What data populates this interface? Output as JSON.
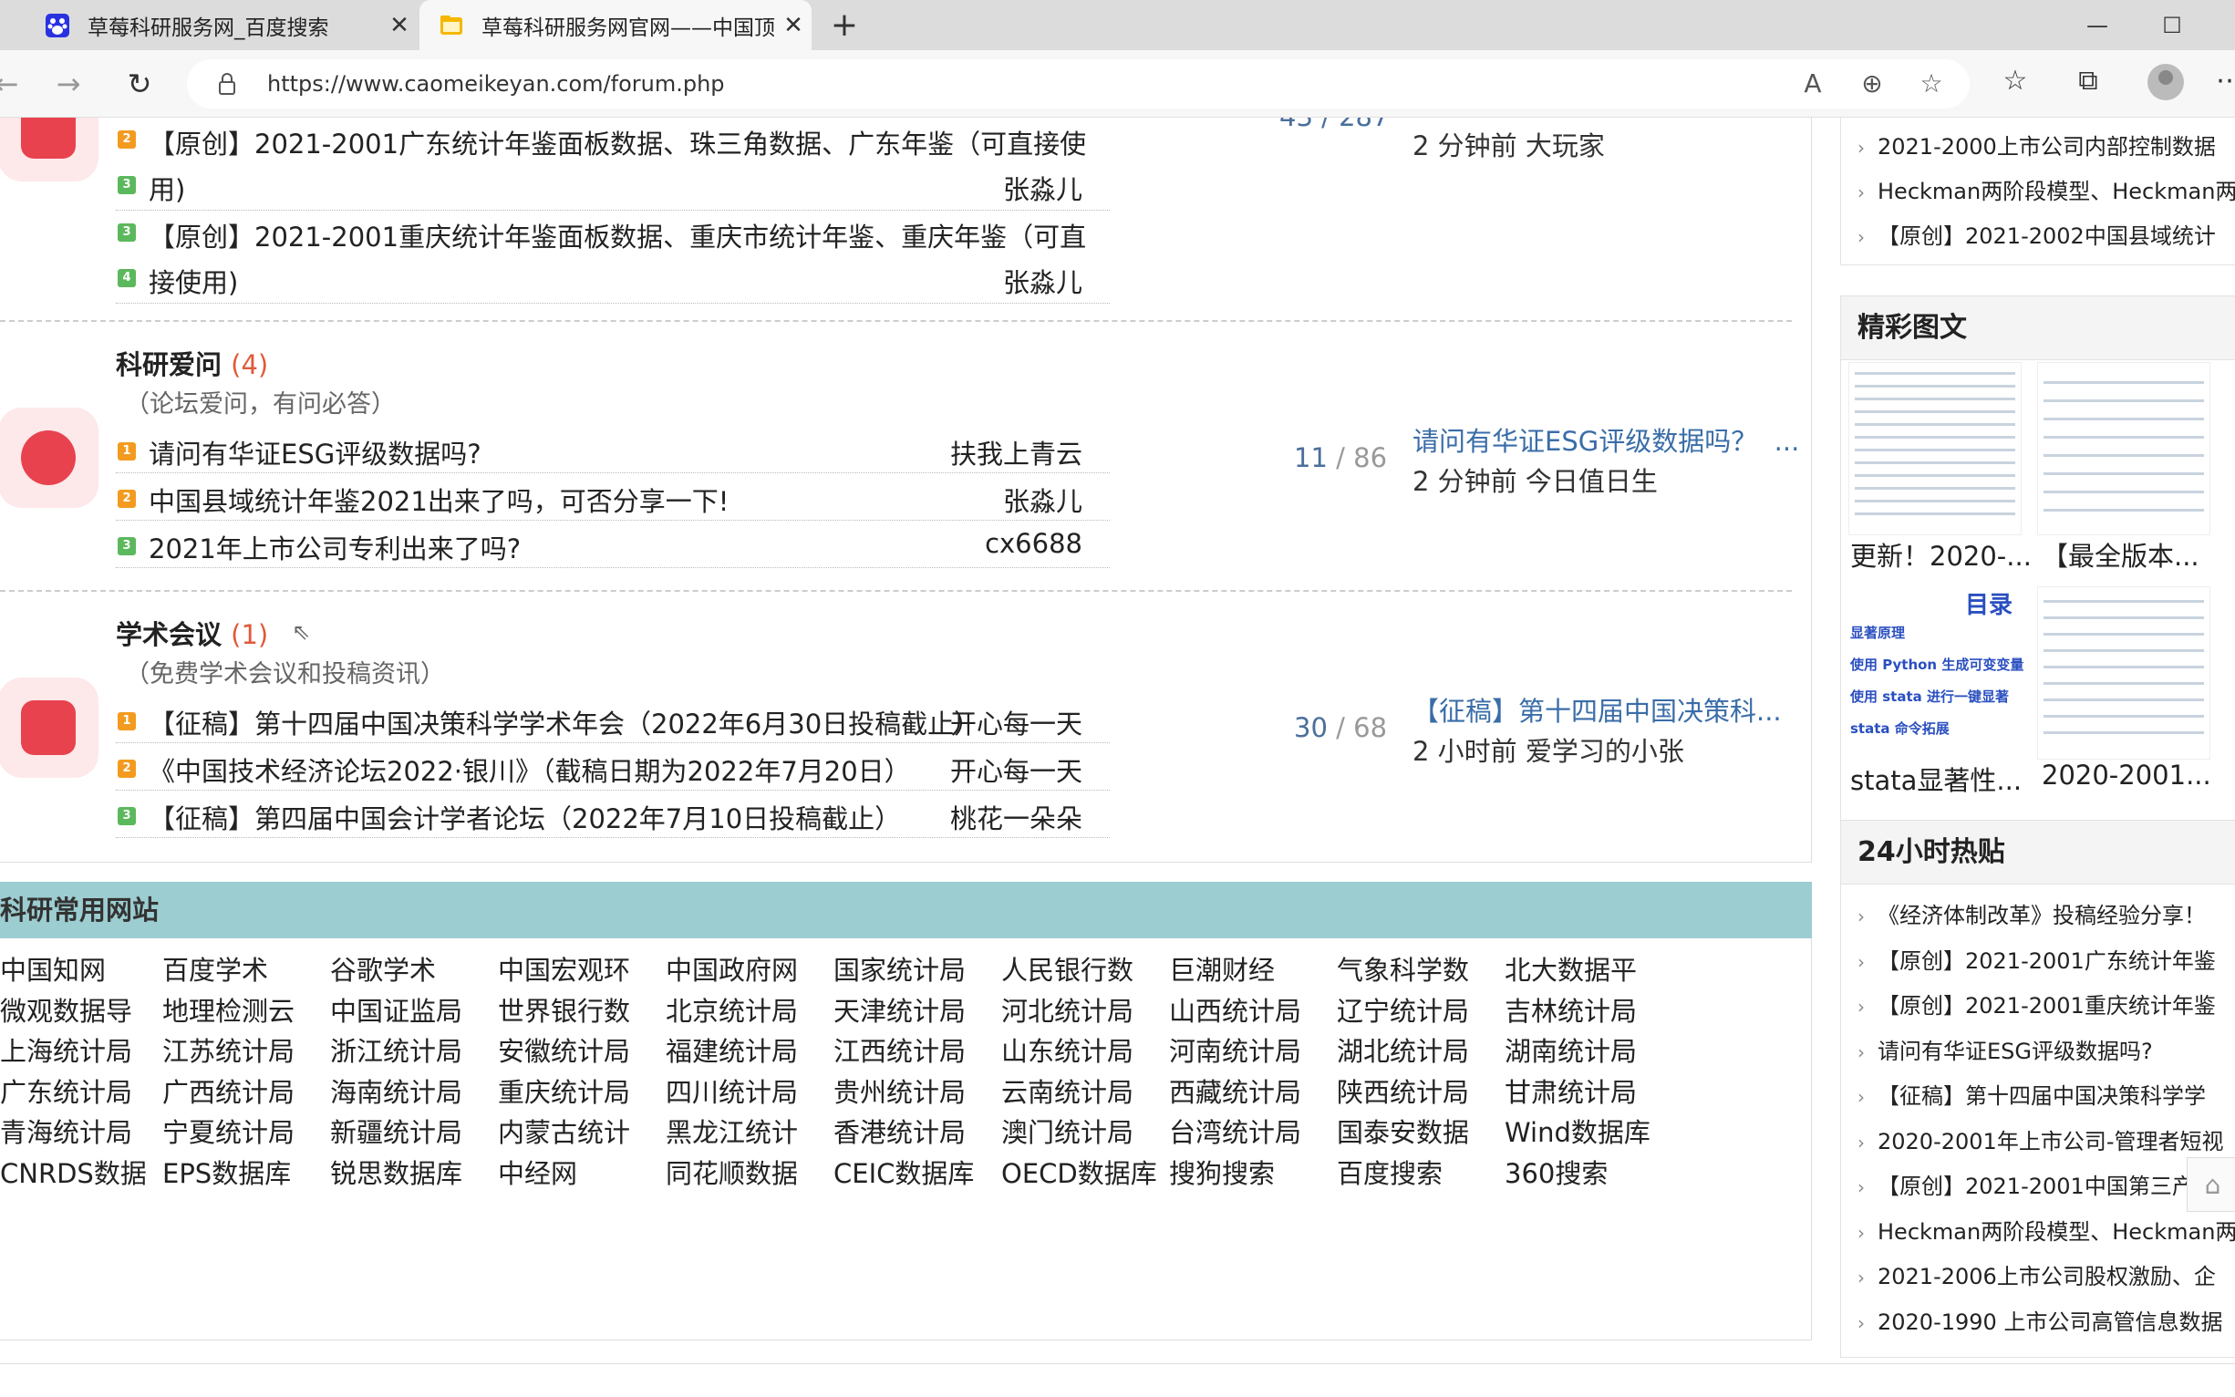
{
  "browser": {
    "tabs": [
      {
        "title": "草莓科研服务网_百度搜索",
        "icon": "baidu-paw-icon",
        "close": "✕"
      },
      {
        "title": "草莓科研服务网官网——中国顶级",
        "icon": "folder-favicon-icon",
        "close": "✕"
      }
    ],
    "new_tab": "+",
    "url": "https://www.caomeikeyan.com/forum.php",
    "window_controls": {
      "minimize": "—",
      "maximize": "☐"
    }
  },
  "forum": {
    "top_section": {
      "stats": "43 / 287",
      "last_post_meta": "2 分钟前 大玩家",
      "threads": [
        {
          "line1": "【原创】2021-2001广东统计年鉴面板数据、珠三角数据、广东年鉴（可直接使",
          "line2": "用)",
          "author": "张淼儿",
          "badge1": "2",
          "badge2": "3"
        },
        {
          "line1": "【原创】2021-2001重庆统计年鉴面板数据、重庆市统计年鉴、重庆年鉴（可直",
          "line2": "接使用)",
          "author": "张淼儿",
          "badge1": "3",
          "badge2": "4"
        }
      ]
    },
    "sections": [
      {
        "title": "科研爱问",
        "count": "(4)",
        "desc": "（论坛爱问，有问必答）",
        "stats": {
          "threads": "11",
          "sep": "/",
          "posts": "86"
        },
        "last_title": "请问有华证ESG评级数据吗？",
        "last_ellipsis": "...",
        "last_meta": "2 分钟前 今日值日生",
        "threads": [
          {
            "badge": "1",
            "title": "请问有华证ESG评级数据吗?",
            "author": "扶我上青云"
          },
          {
            "badge": "2",
            "title": "中国县域统计年鉴2021出来了吗，可否分享一下!",
            "author": "张淼儿"
          },
          {
            "badge": "3",
            "title": "2021年上市公司专利出来了吗?",
            "author": "cx6688"
          }
        ]
      },
      {
        "title": "学术会议",
        "count": "(1)",
        "desc": "（免费学术会议和投稿资讯）",
        "stats": {
          "threads": "30",
          "sep": "/",
          "posts": "68"
        },
        "last_title": "【征稿】第十四届中国决策科...",
        "last_meta": "2 小时前 爱学习的小张",
        "threads": [
          {
            "badge": "1",
            "title": "【征稿】第十四届中国决策科学学术年会（2022年6月30日投稿截止）",
            "author": "开心每一天"
          },
          {
            "badge": "2",
            "title": "《中国技术经济论坛2022·银川》（截稿日期为2022年7月20日）",
            "author": "开心每一天"
          },
          {
            "badge": "3",
            "title": "【征稿】第四届中国会计学者论坛（2022年7月10日投稿截止）",
            "author": "桃花一朵朵"
          }
        ]
      }
    ]
  },
  "links": {
    "title": "科研常用网站",
    "rows": [
      [
        "中国知网",
        "百度学术",
        "谷歌学术",
        "中国宏观环",
        "中国政府网",
        "国家统计局",
        "人民银行数",
        "巨潮财经",
        "气象科学数",
        "北大数据平"
      ],
      [
        "微观数据导",
        "地理检测云",
        "中国证监局",
        "世界银行数",
        "北京统计局",
        "天津统计局",
        "河北统计局",
        "山西统计局",
        "辽宁统计局",
        "吉林统计局"
      ],
      [
        "上海统计局",
        "江苏统计局",
        "浙江统计局",
        "安徽统计局",
        "福建统计局",
        "江西统计局",
        "山东统计局",
        "河南统计局",
        "湖北统计局",
        "湖南统计局"
      ],
      [
        "广东统计局",
        "广西统计局",
        "海南统计局",
        "重庆统计局",
        "四川统计局",
        "贵州统计局",
        "云南统计局",
        "西藏统计局",
        "陕西统计局",
        "甘肃统计局"
      ],
      [
        "青海统计局",
        "宁夏统计局",
        "新疆统计局",
        "内蒙古统计",
        "黑龙江统计",
        "香港统计局",
        "澳门统计局",
        "台湾统计局",
        "国泰安数据",
        "Wind数据库"
      ],
      [
        "CNRDS数据",
        "EPS数据库",
        "锐思数据库",
        "中经网",
        "同花顺数据",
        "CEIC数据库",
        "OECD数据库",
        "搜狗搜索",
        "百度搜索",
        "360搜索"
      ]
    ]
  },
  "sidebar": {
    "top_list": [
      "2021-2000上市公司内部控制数据",
      "Heckman两阶段模型、Heckman两",
      "【原创】2021-2002中国县域统计"
    ],
    "pics_title": "精彩图文",
    "pics": [
      "更新！2020-...",
      "【最全版本...",
      "stata显著性...",
      "2020-2001..."
    ],
    "pic3_text": {
      "mu": "目录",
      "l1": "显著原理",
      "l2": "使用 Python 生成可变变量",
      "l3": "使用 stata 进行一键显著",
      "l4": "stata 命令拓展"
    },
    "hot_title": "24小时热贴",
    "hot": [
      "《经济体制改革》投稿经验分享！",
      "【原创】2021-2001广东统计年鉴",
      "【原创】2021-2001重庆统计年鉴",
      "请问有华证ESG评级数据吗?",
      "【征稿】第十四届中国决策科学学",
      "2020-2001年上市公司-管理者短视",
      "【原创】2021-2001中国第三产业",
      "Heckman两阶段模型、Heckman两",
      "2021-2006上市公司股权激励、企",
      "2020-1990 上市公司高管信息数据"
    ],
    "chevron": "›"
  }
}
